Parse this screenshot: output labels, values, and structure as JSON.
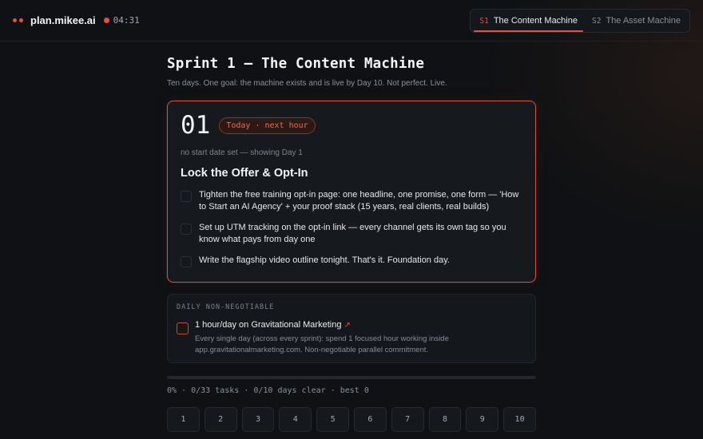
{
  "header": {
    "brand": "plan.mikee.ai",
    "timer": "04:31",
    "accent": "#e0553a",
    "sprints": [
      {
        "code": "S1",
        "name": "The Content Machine",
        "active": true
      },
      {
        "code": "S2",
        "name": "The Asset Machine",
        "active": false
      }
    ]
  },
  "page": {
    "title": "Sprint 1 — The Content Machine",
    "subtitle": "Ten days. One goal: the machine exists and is live by Day 10. Not perfect. Live."
  },
  "day_card": {
    "number": "01",
    "badge": "Today · next hour",
    "start_note": "no start date set — showing Day 1",
    "title": "Lock the Offer & Opt-In",
    "tasks": [
      "Tighten the free training opt-in page: one headline, one promise, one form — 'How to Start an AI Agency' + your proof stack (15 years, real clients, real builds)",
      "Set up UTM tracking on the opt-in link — every channel gets its own tag so you know what pays from day one",
      "Write the flagship video outline tonight. That's it. Foundation day."
    ]
  },
  "non_negotiable": {
    "label": "DAILY NON-NEGOTIABLE",
    "title": "1 hour/day on Gravitational Marketing",
    "arrow": "↗",
    "description": "Every single day (across every sprint): spend 1 focused hour working inside app.gravitationalmarketing.com. Non-negotiable parallel commitment."
  },
  "progress": {
    "percent": 0,
    "stats": "0% · 0/33 tasks · 0/10 days clear · best 0"
  },
  "days": [
    "1",
    "2",
    "3",
    "4",
    "5",
    "6",
    "7",
    "8",
    "9",
    "10"
  ]
}
